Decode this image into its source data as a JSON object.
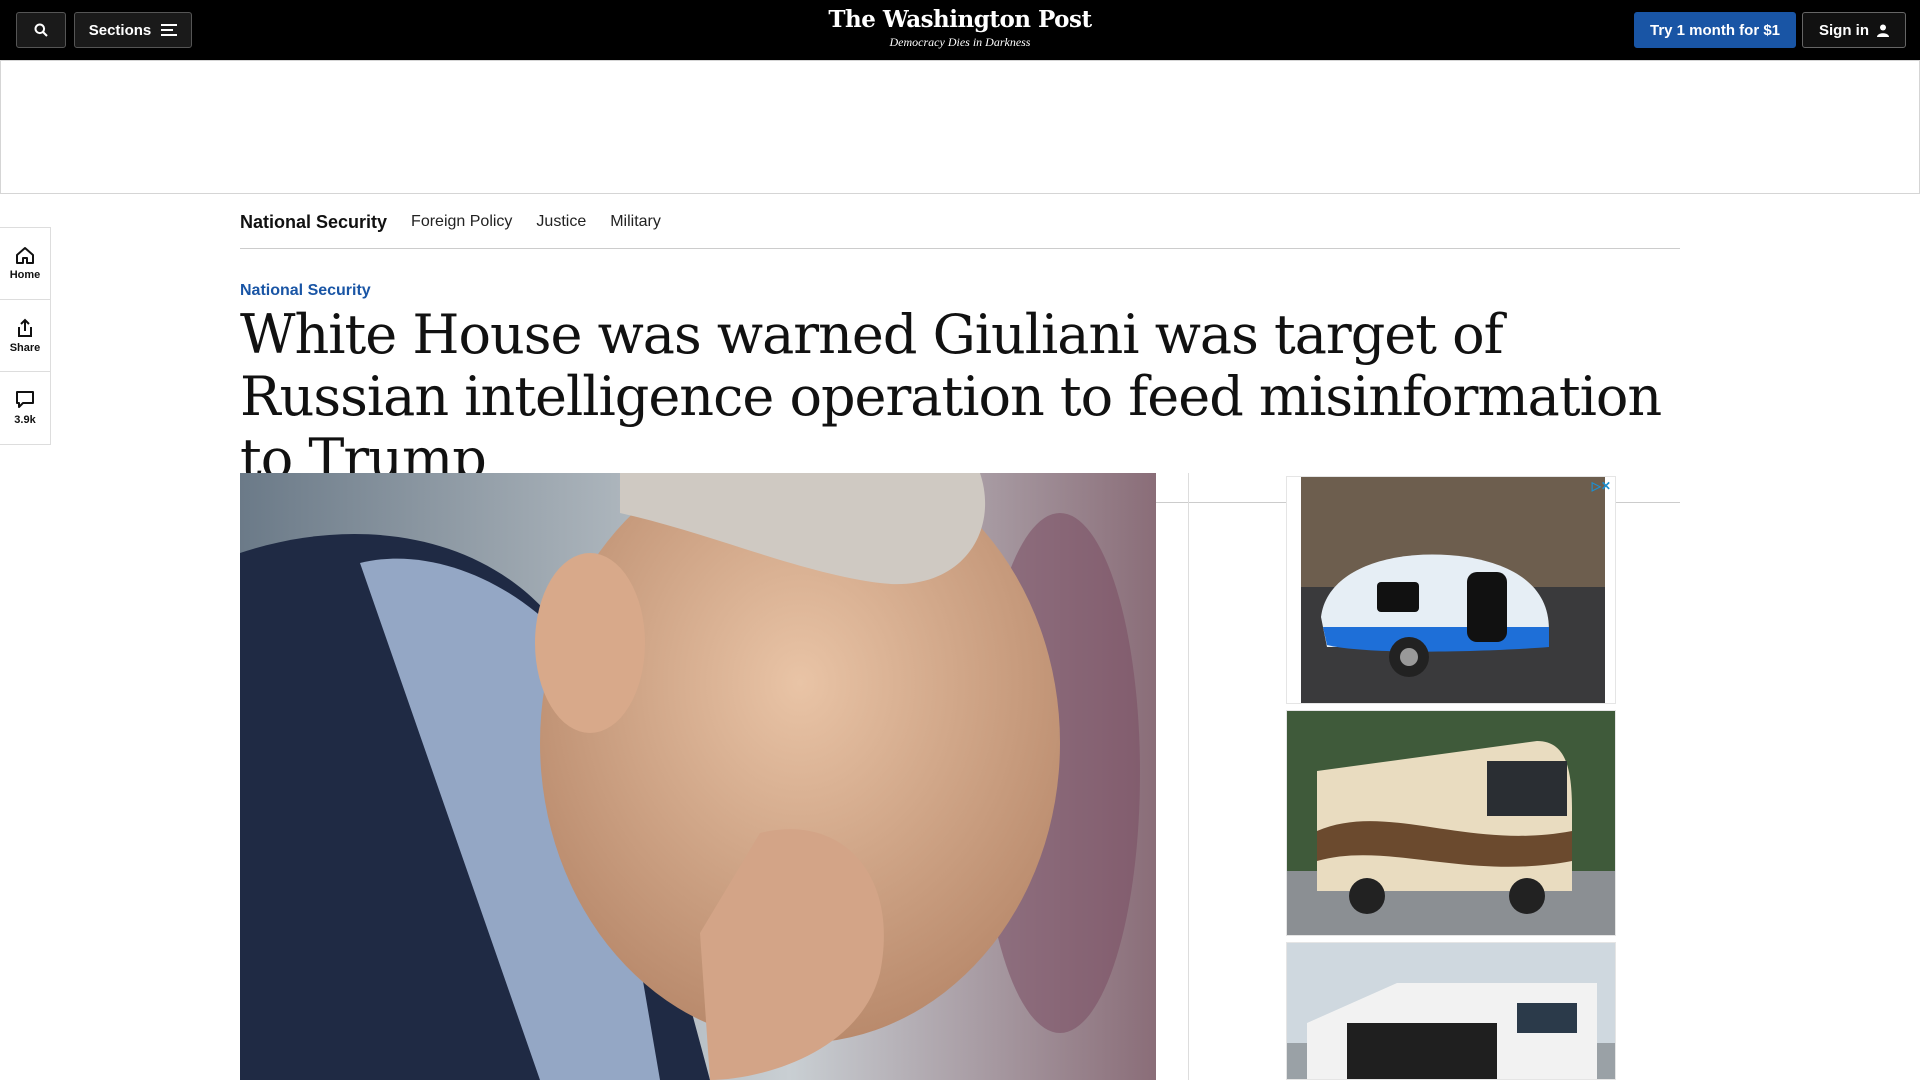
{
  "header": {
    "search_icon": "search-icon",
    "sections_label": "Sections",
    "logo_title": "The Washington Post",
    "logo_tagline": "Democracy Dies in Darkness",
    "trial_label": "Try 1 month for $1",
    "signin_label": "Sign in"
  },
  "subnav": {
    "main": "National Security",
    "links": [
      "Foreign Policy",
      "Justice",
      "Military"
    ]
  },
  "rail": {
    "home_label": "Home",
    "share_label": "Share",
    "comments_count": "3.9k"
  },
  "article": {
    "kicker": "National Security",
    "headline": "White House was warned Giuliani was target of Russian intelligence operation to feed misinformation to Trump"
  },
  "colors": {
    "brand_blue": "#1955a5",
    "topbar": "#000000"
  }
}
